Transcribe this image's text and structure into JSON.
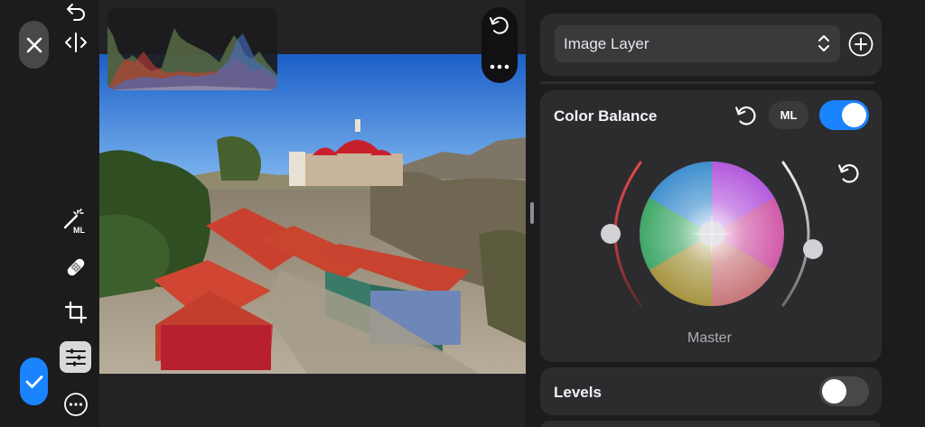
{
  "toolbar": {
    "cancel": "close",
    "confirm": "checkmark",
    "tools": [
      "undo-icon",
      "compare-icon",
      "ml-magic-icon",
      "bandage-icon",
      "crop-icon",
      "adjustments-icon",
      "more-icon"
    ],
    "ml_badge_text": "ML"
  },
  "canvas": {
    "reset_icon": "rotate-ccw-icon",
    "more_icon": "ellipsis-icon"
  },
  "panel": {
    "layer_select": {
      "value": "Image Layer"
    },
    "color_balance": {
      "title": "Color Balance",
      "ml_label": "ML",
      "enabled": true,
      "wheel_label": "Master"
    },
    "levels": {
      "title": "Levels",
      "enabled": false
    }
  },
  "colors": {
    "accent": "#1a84ff",
    "card": "#2c2c2e",
    "background": "#1c1c1e"
  }
}
